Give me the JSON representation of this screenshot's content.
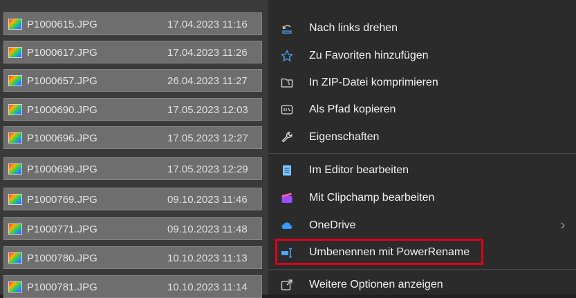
{
  "files": [
    {
      "name": "P1000615.JPG",
      "date": "17.04.2023 11:16"
    },
    {
      "name": "P1000617.JPG",
      "date": "17.04.2023 11:26"
    },
    {
      "name": "P1000657.JPG",
      "date": "26.04.2023 11:27"
    },
    {
      "name": "P1000690.JPG",
      "date": "17.05.2023 12:03"
    },
    {
      "name": "P1000696.JPG",
      "date": "17.05.2023 12:27"
    },
    {
      "name": "P1000699.JPG",
      "date": "17.05.2023 12:29"
    },
    {
      "name": "P1000769.JPG",
      "date": "09.10.2023 11:46"
    },
    {
      "name": "P1000771.JPG",
      "date": "09.10.2023 11:48"
    },
    {
      "name": "P1000780.JPG",
      "date": "10.10.2023 11:13"
    },
    {
      "name": "P1000781.JPG",
      "date": "10.10.2023 11:14"
    }
  ],
  "menu": {
    "items": [
      {
        "label": "Nach links drehen",
        "icon": "rotate-left-icon"
      },
      {
        "label": "Zu Favoriten hinzufügen",
        "icon": "star-icon"
      },
      {
        "label": "In ZIP-Datei komprimieren",
        "icon": "zip-folder-icon"
      },
      {
        "label": "Als Pfad kopieren",
        "icon": "copy-path-icon"
      },
      {
        "label": "Eigenschaften",
        "icon": "wrench-icon"
      },
      {
        "label": "Im Editor bearbeiten",
        "icon": "notepad-icon"
      },
      {
        "label": "Mit Clipchamp bearbeiten",
        "icon": "clipchamp-icon"
      },
      {
        "label": "OneDrive",
        "icon": "onedrive-icon",
        "has_submenu": true
      },
      {
        "label": "Umbenennen mit PowerRename",
        "icon": "powerrename-icon",
        "highlighted": true
      },
      {
        "label": "Weitere Optionen anzeigen",
        "icon": "more-options-icon"
      }
    ]
  },
  "colors": {
    "highlight": "#e0001a",
    "menu_bg": "#2b2b2b",
    "row_bg": "#6e6e6e"
  }
}
